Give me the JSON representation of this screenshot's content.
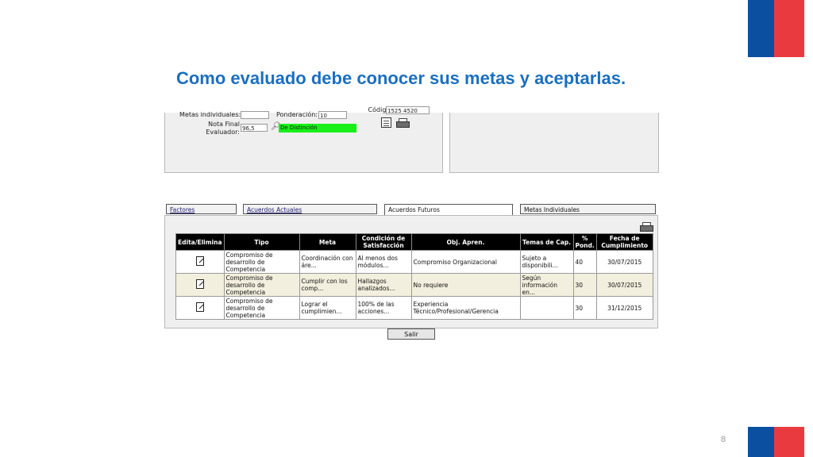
{
  "slide": {
    "title": "Como evaluado debe conocer sus metas y aceptarlas.",
    "page_number": "8",
    "colors": {
      "title": "#1a6fc0",
      "flag_blue": "#0a4fa0",
      "flag_red": "#e93b3f"
    }
  },
  "upper_form": {
    "metas_label": "Metas individuales:",
    "ponderacion_label": "Ponderación:",
    "ponderacion_value": "10",
    "nota_final_label": "Nota Final",
    "evaluador_label": "Evaluador:",
    "nota_value": "96,5",
    "distincion_value": "De Distinción",
    "codigo_label": "Código:",
    "codigo_value": "1525 4520",
    "icons": [
      "magnifier-icon",
      "document-icon",
      "printer-icon"
    ]
  },
  "tabs": [
    {
      "label": "Factores"
    },
    {
      "label": "Acuerdos Actuales"
    },
    {
      "label": "Acuerdos Futuros"
    },
    {
      "label": "Metas Individuales"
    }
  ],
  "table": {
    "headers": [
      "Edita/Elimina",
      "Tipo",
      "Meta",
      "Condición de Satisfacción",
      "Obj. Apren.",
      "Temas de Cap.",
      "% Pond.",
      "Fecha de Cumplimiento"
    ],
    "rows": [
      {
        "tipo": "Compromiso de desarrollo de Competencia",
        "meta": "Coordinación con áre...",
        "condicion": "Al menos dos módulos...",
        "obj": "Compromiso Organizacional",
        "temas": "Sujeto a disponibili...",
        "pond": "40",
        "fecha": "30/07/2015"
      },
      {
        "tipo": "Compromiso de desarrollo de Competencia",
        "meta": "Cumplir con los comp...",
        "condicion": "Hallazgos analizados...",
        "obj": "No requiere",
        "temas": "Según información en...",
        "pond": "30",
        "fecha": "30/07/2015"
      },
      {
        "tipo": "Compromiso de desarrollo de Competencia",
        "meta": "Lograr el cumplimien...",
        "condicion": "100% de las acciones...",
        "obj": "Experiencia Técnico/Profesional/Gerencia",
        "temas": "",
        "pond": "30",
        "fecha": "31/12/2015"
      }
    ]
  },
  "buttons": {
    "salir": "Salir"
  }
}
